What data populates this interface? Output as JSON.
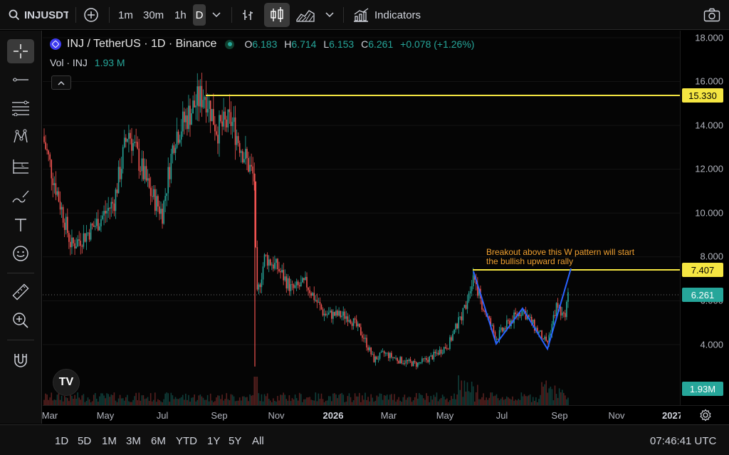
{
  "toolbar": {
    "symbol": "INJUSDT",
    "intervals": [
      "1m",
      "30m",
      "1h",
      "D"
    ],
    "indicators_label": "Indicators"
  },
  "legend": {
    "pair": "INJ / TetherUS · 1D · Binance",
    "o_label": "O",
    "o": "6.183",
    "h_label": "H",
    "h": "6.714",
    "l_label": "L",
    "l": "6.153",
    "c_label": "C",
    "c": "6.261",
    "change": "+0.078 (+1.26%)",
    "vol_label": "Vol · INJ",
    "vol_value": "1.93 M"
  },
  "annotation": {
    "line1": "Breakout above this W pattern will start",
    "line2": "the bullish upward rally"
  },
  "price_axis": {
    "labels": [
      "18.000",
      "16.000",
      "14.000",
      "12.000",
      "10.000",
      "8.000",
      "6.000",
      "4.000"
    ],
    "tags": {
      "resistance": "15.330",
      "breakout": "7.407",
      "last_price": "6.261",
      "volume": "1.93M"
    }
  },
  "time_axis": {
    "labels": [
      "Mar",
      "May",
      "Jul",
      "Sep",
      "Nov",
      "2026",
      "Mar",
      "May",
      "Jul",
      "Sep",
      "Nov",
      "2027"
    ]
  },
  "bottom": {
    "ranges": [
      "1D",
      "5D",
      "1M",
      "3M",
      "6M",
      "YTD",
      "1Y",
      "5Y",
      "All"
    ],
    "clock": "07:46:41 UTC"
  },
  "tv_logo": "TV",
  "colors": {
    "up": "#26a69a",
    "down": "#ef5350",
    "line_yellow": "#f5e642",
    "pattern_blue": "#2962ff",
    "annotation_orange": "#f0a030"
  },
  "chart_data": {
    "type": "candlestick",
    "symbol": "INJ / TetherUS",
    "interval": "1D",
    "ylim": [
      2.5,
      18.0
    ],
    "price_ticks": [
      4,
      6,
      8,
      10,
      12,
      14,
      16,
      18
    ],
    "horizontal_lines": [
      {
        "price": 15.33
      },
      {
        "price": 7.407
      }
    ],
    "last_price": 6.261,
    "approx_path": [
      {
        "date": "2025-03",
        "price": 13.5
      },
      {
        "date": "2025-04",
        "price": 8.5
      },
      {
        "date": "2025-05",
        "price": 10.5
      },
      {
        "date": "2025-06",
        "price": 13.5
      },
      {
        "date": "2025-07",
        "price": 11.0
      },
      {
        "date": "2025-08",
        "price": 15.5
      },
      {
        "date": "2025-09",
        "price": 14.0
      },
      {
        "date": "2025-10",
        "price": 12.0
      },
      {
        "date": "2025-11",
        "price": 7.0
      },
      {
        "date": "2026-01",
        "price": 5.2
      },
      {
        "date": "2026-02",
        "price": 3.4
      },
      {
        "date": "2026-03",
        "price": 3.0
      },
      {
        "date": "2026-05",
        "price": 4.4
      },
      {
        "date": "2026-06",
        "price": 7.4
      },
      {
        "date": "2026-07",
        "price": 5.0
      },
      {
        "date": "2026-09",
        "price": 6.26
      }
    ],
    "w_pattern": [
      7.4,
      4.1,
      5.6,
      3.9,
      7.4
    ]
  }
}
